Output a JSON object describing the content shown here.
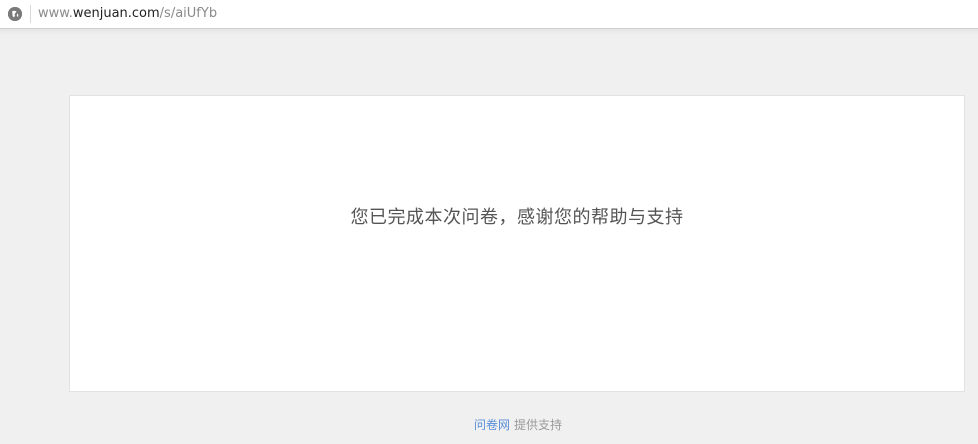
{
  "browser": {
    "url": "www.wenjuan.com/s/aiUfYb",
    "url_prefix": "www.",
    "url_host": "wenjuan.com",
    "url_path": "/s/aiUfYb",
    "site_icon": "globe-info-icon"
  },
  "main": {
    "message": "您已完成本次问卷，感谢您的帮助与支持"
  },
  "footer": {
    "brand_link": "问卷网",
    "support_text": "提供支持",
    "link_color": "#5a8fd8"
  }
}
